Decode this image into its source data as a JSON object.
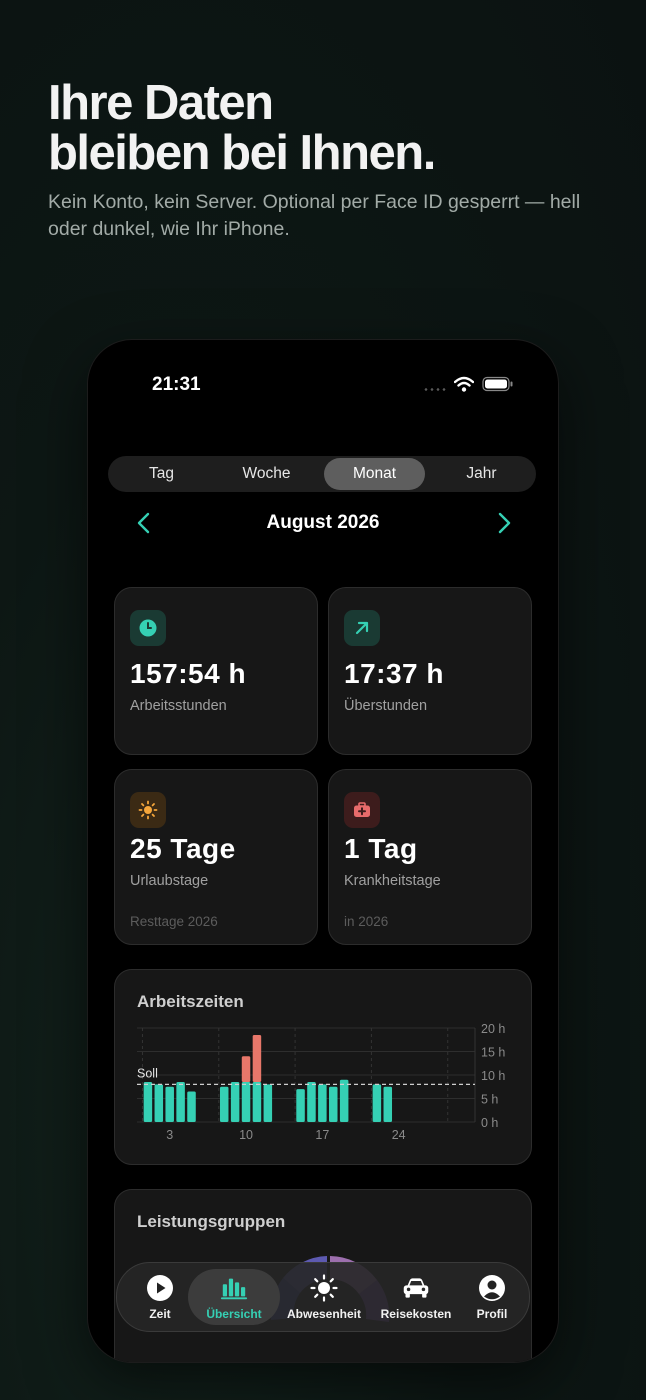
{
  "hero": {
    "title_line1": "Ihre Daten",
    "title_line2": "bleiben bei Ihnen.",
    "subtitle": "Kein Konto, kein Server. Optional per Face ID gesperrt — hell oder dunkel, wie Ihr iPhone."
  },
  "status_bar": {
    "time": "21:31"
  },
  "segments": [
    {
      "label": "Tag",
      "active": false
    },
    {
      "label": "Woche",
      "active": false
    },
    {
      "label": "Monat",
      "active": true
    },
    {
      "label": "Jahr",
      "active": false
    }
  ],
  "period": {
    "title": "August 2026"
  },
  "cards": {
    "work": {
      "value": "157:54 h",
      "label": "Arbeitsstunden",
      "icon": "clock-icon"
    },
    "overtime": {
      "value": "17:37 h",
      "label": "Überstunden",
      "icon": "arrow-up-right-icon"
    },
    "vacation": {
      "value": "25 Tage",
      "label": "Urlaubstage",
      "footer": "Resttage 2026",
      "icon": "sun-icon"
    },
    "sick": {
      "value": "1 Tag",
      "label": "Krankheitstage",
      "footer": "in 2026",
      "icon": "medical-kit-icon"
    }
  },
  "colors": {
    "accent": "#35d0b4",
    "overtime": "#e8776a",
    "vacation": "#f5a63b",
    "sick": "#e86b6b"
  },
  "chart_data": {
    "type": "bar",
    "title": "Arbeitszeiten",
    "x": [
      1,
      2,
      3,
      4,
      5,
      8,
      9,
      10,
      11,
      12,
      15,
      16,
      17,
      18,
      19,
      22,
      23
    ],
    "series": [
      {
        "values": [
          8.5,
          8,
          7.5,
          8.5,
          6.5,
          7.5,
          8.5,
          8.5,
          8.5,
          8,
          7,
          8.5,
          8,
          7.5,
          9,
          8,
          7.5
        ]
      },
      {
        "values": [
          0,
          0,
          0,
          0,
          0,
          0,
          0,
          5.5,
          0,
          0,
          0,
          0,
          0,
          0,
          0,
          0,
          0
        ]
      },
      {
        "values": [
          0,
          0,
          0,
          0,
          0,
          0,
          0,
          0,
          10,
          0,
          0,
          0,
          0,
          0,
          0,
          0,
          0
        ]
      }
    ],
    "x_ticks": [
      "3",
      "10",
      "17",
      "24"
    ],
    "x_tick_values": [
      3,
      10,
      17,
      24
    ],
    "y_ticks": [
      "0 h",
      "5 h",
      "10 h",
      "15 h",
      "20 h"
    ],
    "y_tick_values": [
      0,
      5,
      10,
      15,
      20
    ],
    "ylim": [
      0,
      20
    ],
    "xlim": [
      0,
      31
    ],
    "reference_line": {
      "label": "Soll",
      "value": 8
    },
    "grid": true
  },
  "groups": {
    "title": "Leistungsgruppen"
  },
  "tabbar": {
    "items": [
      {
        "label": "Zeit",
        "icon": "play-icon",
        "active": false
      },
      {
        "label": "Übersicht",
        "icon": "bar-chart-icon",
        "active": true
      },
      {
        "label": "Abwesenheit",
        "icon": "sun-icon",
        "active": false
      },
      {
        "label": "Reisekosten",
        "icon": "car-icon",
        "active": false
      },
      {
        "label": "Profil",
        "icon": "profile-icon",
        "active": false
      }
    ]
  }
}
